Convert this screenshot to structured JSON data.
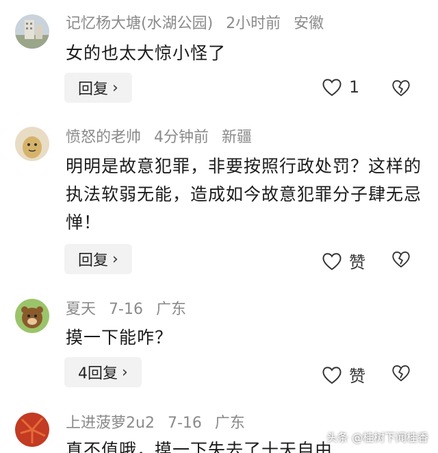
{
  "comments": [
    {
      "username": "记忆杨大塘(水湖公园)",
      "time": "2小时前",
      "location": "安徽",
      "text": "女的也太大惊小怪了",
      "reply_label": "回复",
      "like_label": "1"
    },
    {
      "username": "愤怒的老帅",
      "time": "4分钟前",
      "location": "新疆",
      "text": "明明是故意犯罪，非要按照行政处罚？这样的执法软弱无能，造成如今故意犯罪分子肆无忌惮！",
      "reply_label": "回复",
      "like_label": "赞"
    },
    {
      "username": "夏天",
      "time": "7-16",
      "location": "广东",
      "text": "摸一下能咋？",
      "reply_label": "4回复",
      "like_label": "赞"
    },
    {
      "username": "上进菠萝2u2",
      "time": "7-16",
      "location": "广东",
      "text": "真不值哦，摸一下失去了十天自由",
      "reply_label": "",
      "like_label": ""
    }
  ],
  "watermark": "头条 @桂树下闻桂香",
  "icons": {
    "like": "heart-outline-icon",
    "dislike": "broken-heart-icon",
    "chevron": "chevron-right-icon"
  }
}
